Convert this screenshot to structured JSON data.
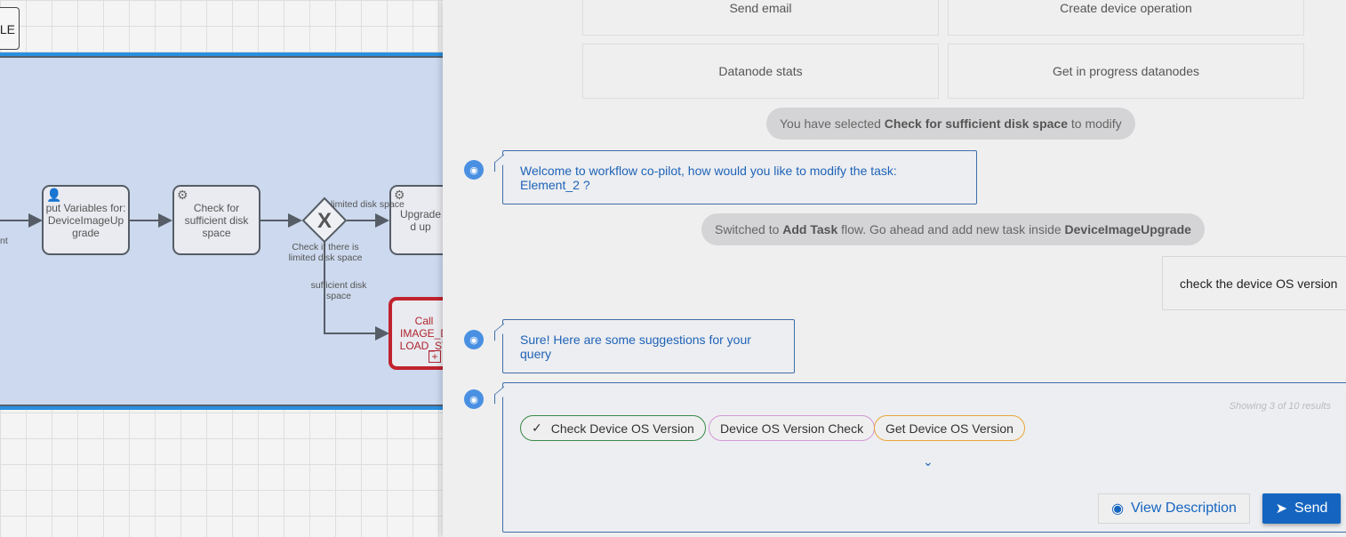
{
  "canvas": {
    "top_label": "LE",
    "tasks": {
      "input_variables": "put Variables for: DeviceImageUp grade",
      "check_disk": "Check for sufficient disk space",
      "upgrade": "Upgrade d up",
      "call_activity": "Call IMAGE_D LOAD_ST"
    },
    "labels": {
      "left_edge": "nt",
      "gateway": "Check if there is limited disk space",
      "limited": "limited disk space",
      "sufficient": "sufficient disk space"
    }
  },
  "panel": {
    "options": [
      "Send email",
      "Create device operation",
      "Datanode stats",
      "Get in progress datanodes"
    ],
    "sys_selected": {
      "pre": "You have selected ",
      "bold": "Check for sufficient disk space",
      "post": " to modify"
    },
    "bot_welcome": "Welcome to workflow co-pilot, how would you like to modify the task: Element_2 ?",
    "sys_switched": {
      "pre": "Switched to ",
      "bold1": "Add Task",
      "mid": " flow. Go ahead and add new task inside ",
      "bold2": "DeviceImageUpgrade"
    },
    "user_message": "check the device OS version",
    "bot_suggest": "Sure! Here are some suggestions for your query",
    "results_count": "Showing 3 of 10 results",
    "suggestions": [
      {
        "label": "Check Device OS Version",
        "selected": true,
        "color": "#3a8a4a"
      },
      {
        "label": "Device OS Version Check",
        "selected": false,
        "color": "#d49ad6"
      },
      {
        "label": "Get Device OS Version",
        "selected": false,
        "color": "#e8a53a"
      }
    ],
    "view_description": "View Description",
    "send": "Send",
    "accent": "#1565c0"
  }
}
